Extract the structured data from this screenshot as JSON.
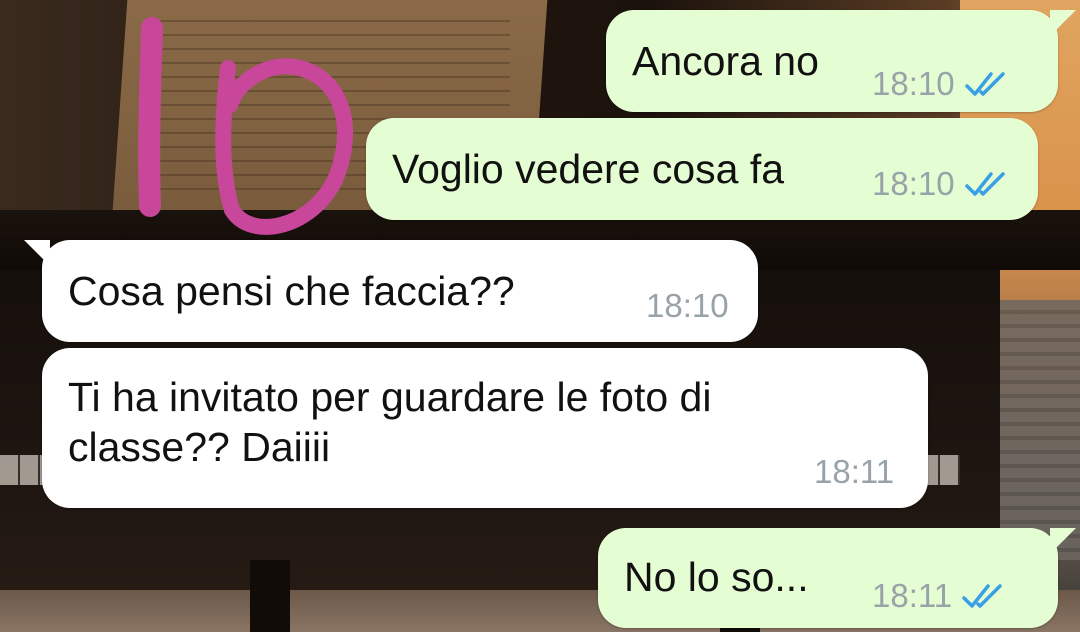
{
  "annotation": {
    "handwritten_text": "Io",
    "color": "#c8479a"
  },
  "colors": {
    "outgoing_bubble": "#e5fdd3",
    "incoming_bubble": "#ffffff",
    "read_tick": "#3aa0e6",
    "timestamp": "#98a3a9"
  },
  "messages": [
    {
      "direction": "outgoing",
      "text": "Ancora no",
      "time": "18:10",
      "status": "read"
    },
    {
      "direction": "outgoing",
      "text": "Voglio vedere cosa fa",
      "time": "18:10",
      "status": "read"
    },
    {
      "direction": "incoming",
      "text": "Cosa pensi che faccia??",
      "time": "18:10"
    },
    {
      "direction": "incoming",
      "text": "Ti ha invitato per guardare le foto di\nclasse?? Daiiii",
      "time": "18:11"
    },
    {
      "direction": "outgoing",
      "text": "No lo so...",
      "time": "18:11",
      "status": "read"
    }
  ],
  "icons": {
    "read_receipt": "double-check-icon"
  }
}
